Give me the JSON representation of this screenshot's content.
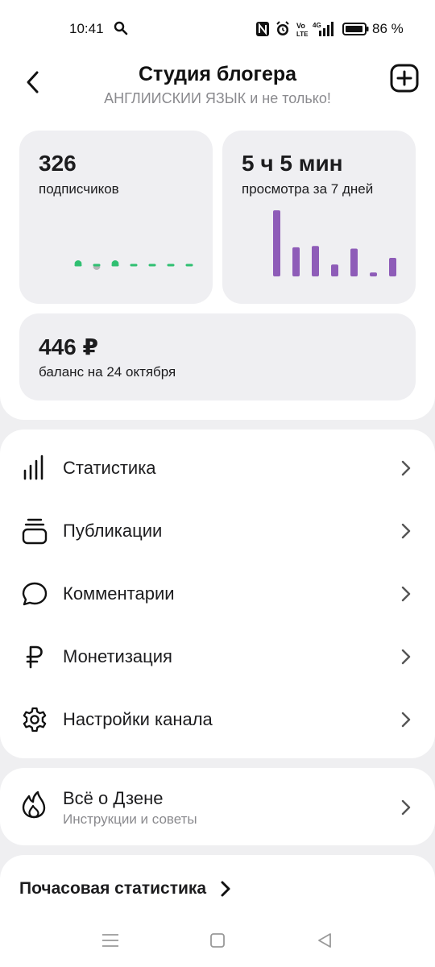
{
  "status_bar": {
    "time": "10:41",
    "battery": "86 %",
    "icons": [
      "search-icon",
      "nfc-icon",
      "alarm-icon",
      "volte-icon",
      "signal-4g-icon",
      "battery-icon"
    ]
  },
  "header": {
    "title": "Студия блогера",
    "subtitle": "АНГЛИИСКИИ ЯЗЫК и не только!"
  },
  "stats": {
    "subscribers": {
      "value": "326",
      "label": "подписчиков",
      "trend": [
        1,
        0,
        1,
        0,
        0,
        0,
        0
      ],
      "trend_colors": {
        "up": "#2fbf71",
        "down": "#b5b5b8"
      }
    },
    "views": {
      "value": "5 ч 5 мин",
      "label": "просмотра за 7 дней",
      "bars": [
        100,
        44,
        46,
        18,
        42,
        6,
        28
      ],
      "bar_color": "#8e5cb8"
    },
    "balance": {
      "value": "446 ₽",
      "label": "баланс на 24 октября"
    }
  },
  "menu": {
    "items": [
      {
        "label": "Статистика",
        "icon": "bar-chart-icon"
      },
      {
        "label": "Публикации",
        "icon": "stack-icon"
      },
      {
        "label": "Комментарии",
        "icon": "comment-icon"
      },
      {
        "label": "Монетизация",
        "icon": "ruble-icon"
      },
      {
        "label": "Настройки канала",
        "icon": "gear-icon"
      }
    ]
  },
  "about": {
    "title": "Всё о Дзене",
    "subtitle": "Инструкции и советы"
  },
  "hourly": {
    "title": "Почасовая статистика"
  }
}
